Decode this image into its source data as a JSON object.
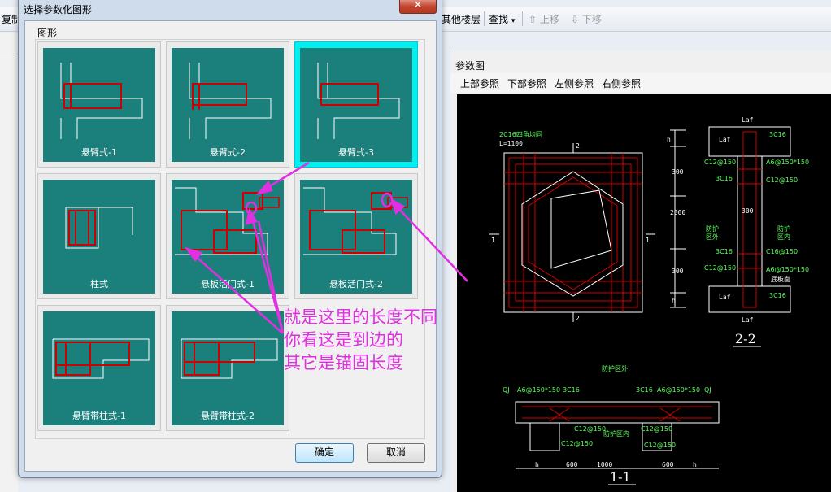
{
  "toolbar": {
    "copy": "复制",
    "other_floors": "其他楼层",
    "find": "查找",
    "move_up": "上移",
    "move_down": "下移"
  },
  "param_panel": {
    "title": "参数图",
    "tabs": [
      "上部参照",
      "下部参照",
      "左侧参照",
      "右侧参照"
    ]
  },
  "drawing": {
    "label_1_1": "1-1",
    "label_2_2": "2-2",
    "corner_text": "2C16四角均同",
    "corner_len": "L=1100",
    "protect_outer": "防护区外",
    "protect_inner": "防护区内",
    "protect_a": "防护",
    "protect_outer_short": "区外",
    "protect_b": "防护",
    "protect_inner_short": "区内",
    "floor_top": "底板面",
    "rebar": {
      "c16": "3C16",
      "a6": "A6@150*150",
      "c12": "C12@150",
      "c16s": "C16@150",
      "laf": "Laf",
      "qj": "QJ",
      "d300": "300",
      "d2000": "2000",
      "d600": "600",
      "d1000": "1000",
      "h": "h"
    }
  },
  "dialog": {
    "title": "选择参数化图形",
    "close": "✕",
    "group": "图形",
    "tiles": [
      {
        "label": "悬臂式-1"
      },
      {
        "label": "悬臂式-2"
      },
      {
        "label": "悬臂式-3"
      },
      {
        "label": "柱式"
      },
      {
        "label": "悬板活门式-1"
      },
      {
        "label": "悬板活门式-2"
      },
      {
        "label": "悬臂带柱式-1"
      },
      {
        "label": "悬臂带柱式-2"
      }
    ],
    "ok": "确定",
    "cancel": "取消"
  },
  "annotation": {
    "line1": "就是这里的长度不同",
    "line2": "你看这是到边的",
    "line3": "其它是锚固长度"
  },
  "colors": {
    "tile_bg": "#1b7f7c",
    "selected": "#00f0f0",
    "rebar_red": "#d00000",
    "annotation": "#e030e0"
  }
}
